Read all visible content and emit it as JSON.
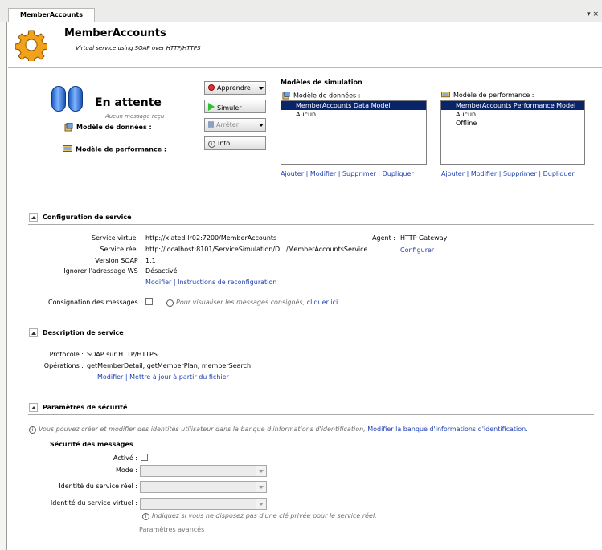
{
  "tab": {
    "label": "MemberAccounts",
    "menu_glyph": "▾ ×"
  },
  "header": {
    "title": "MemberAccounts",
    "subtitle": "Virtual service using SOAP over HTTP/HTTPS"
  },
  "status": {
    "title": "En attente",
    "subtitle": "Aucun message reçu",
    "data_model_label": "Modèle de données :",
    "perf_model_label": "Modèle de performance :"
  },
  "buttons": {
    "learn": "Apprendre",
    "simulate": "Simuler",
    "stop": "Arrêter",
    "info": "Info"
  },
  "simulation_models": {
    "title": "Modèles de simulation",
    "data_models": {
      "label": "Modèle de données :",
      "items": [
        "MemberAccounts Data Model",
        "Aucun"
      ],
      "selected": "MemberAccounts Data Model",
      "actions": [
        "Ajouter",
        "Modifier",
        "Supprimer",
        "Dupliquer"
      ]
    },
    "perf_models": {
      "label": "Modèle de performance :",
      "items": [
        "MemberAccounts Performance Model",
        "Aucun",
        "Offline"
      ],
      "selected": "MemberAccounts Performance Model",
      "actions": [
        "Ajouter",
        "Modifier",
        "Supprimer",
        "Dupliquer"
      ]
    }
  },
  "service_config": {
    "heading": "Configuration de service",
    "rows": [
      {
        "label": "Service virtuel :",
        "value": "http://xlated-lr02:7200/MemberAccounts"
      },
      {
        "label": "Service réel :",
        "value": "http://localhost:8101/ServiceSimulation/D.../MemberAccountsService"
      },
      {
        "label": "Version SOAP :",
        "value": "1.1"
      },
      {
        "label": "Ignorer l'adressage WS :",
        "value": "Désactivé"
      }
    ],
    "links": [
      "Modifier",
      "Instructions de reconfiguration"
    ],
    "agent_label": "Agent :",
    "agent_value": "HTTP Gateway",
    "agent_link": "Configurer",
    "logging_label": "Consignation des messages :",
    "logging_hint": "Pour visualiser les messages consignés,",
    "logging_link": "cliquer ici."
  },
  "service_desc": {
    "heading": "Description de service",
    "protocol_label": "Protocole :",
    "protocol_value": "SOAP sur HTTP/HTTPS",
    "operations_label": "Opérations :",
    "operations_value": "getMemberDetail, getMemberPlan, memberSearch",
    "links": [
      "Modifier",
      "Mettre à jour à partir du fichier"
    ]
  },
  "security": {
    "heading": "Paramètres de sécurité",
    "hint": "Vous pouvez créer et modifier des identités utilisateur dans la banque d'informations d'identification,",
    "hint_link": "Modifier la banque d'informations d'identification.",
    "msg_security_title": "Sécurité des messages",
    "active_label": "Activé :",
    "mode_label": "Mode :",
    "real_identity_label": "Identité du service réel :",
    "virtual_identity_label": "Identité du service virtuel :",
    "private_key_hint": "Indiquez si vous ne disposez pas d'une clé privée pour le service réel.",
    "advanced": "Paramètres avancés"
  },
  "colors": {
    "link": "#1f3fb0",
    "selection": "#0a246a",
    "pause_icon": "#1e62c7"
  },
  "icons": [
    "gear-icon",
    "pause-icon",
    "data-model-icon",
    "performance-model-icon",
    "record-icon",
    "play-icon",
    "stop-icon",
    "info-icon",
    "collapse-icon"
  ]
}
